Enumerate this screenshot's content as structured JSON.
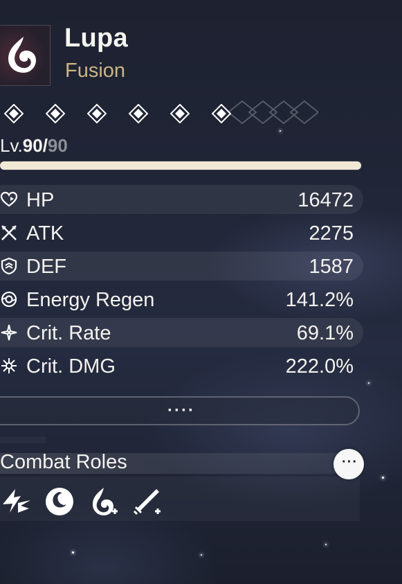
{
  "character": {
    "name": "Lupa",
    "element": "Fusion",
    "emblem_icon": "fusion-flame-icon"
  },
  "resonance": {
    "count": 6,
    "icon": "diamond-node-icon"
  },
  "level": {
    "prefix": "Lv.",
    "current": "90",
    "separator": "/",
    "max": "90",
    "progress": 1.0
  },
  "stats": [
    {
      "label": "HP",
      "value": "16472",
      "icon": "heart-icon"
    },
    {
      "label": "ATK",
      "value": "2275",
      "icon": "crossed-swords-icon"
    },
    {
      "label": "DEF",
      "value": "1587",
      "icon": "shield-icon"
    },
    {
      "label": "Energy Regen",
      "value": "141.2%",
      "icon": "energy-regen-icon"
    },
    {
      "label": "Crit. Rate",
      "value": "69.1%",
      "icon": "crit-rate-icon"
    },
    {
      "label": "Crit. DMG",
      "value": "222.0%",
      "icon": "crit-dmg-icon"
    }
  ],
  "more_button": {
    "label": "····",
    "icon": "more-dots-icon"
  },
  "combat_roles": {
    "title": "Combat Roles",
    "info_label": "···",
    "roles": [
      {
        "icon": "lightning-strike-icon"
      },
      {
        "icon": "swirl-orb-icon"
      },
      {
        "icon": "fusion-plus-icon"
      },
      {
        "icon": "sword-plus-icon"
      }
    ]
  },
  "colors": {
    "accent_gold": "#cdb585",
    "text": "#f4f3ef",
    "bar_fill": "#f0e9d6",
    "muted": "#8b8f97"
  }
}
